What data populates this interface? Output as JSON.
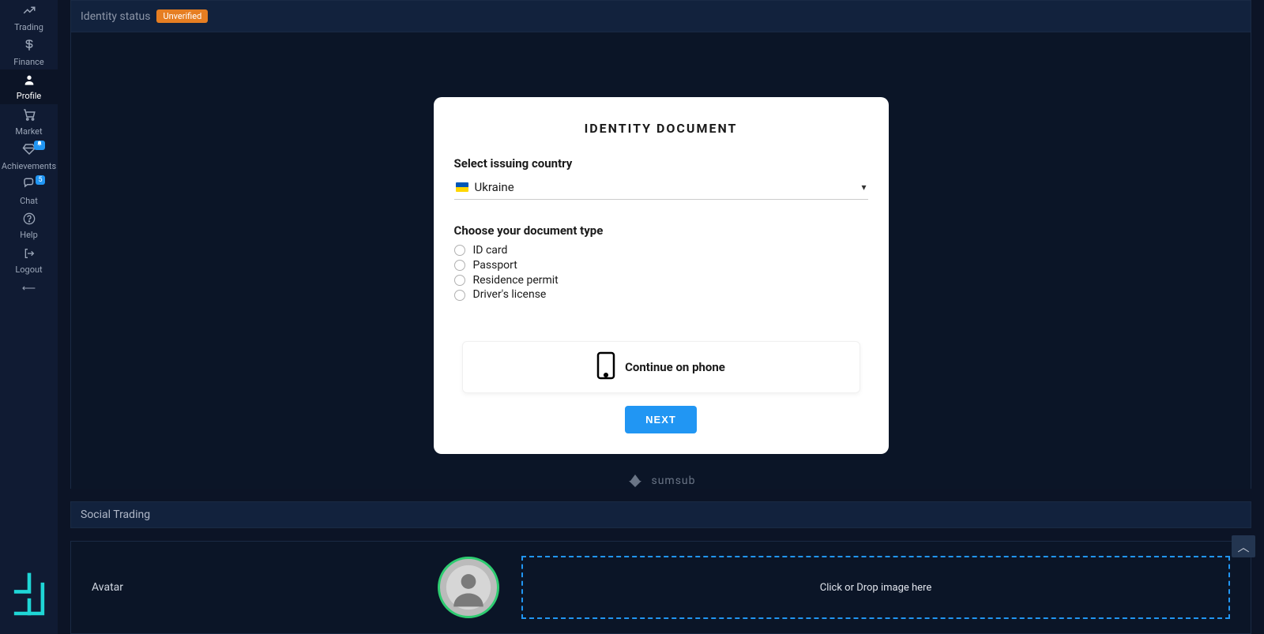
{
  "sidebar": {
    "items": [
      {
        "label": "Trading",
        "icon": "chart-line"
      },
      {
        "label": "Finance",
        "icon": "dollar"
      },
      {
        "label": "Profile",
        "icon": "user",
        "active": true
      },
      {
        "label": "Market",
        "icon": "cart"
      },
      {
        "label": "Achievements",
        "icon": "diamond",
        "badge": " "
      },
      {
        "label": "Chat",
        "icon": "comments",
        "badge": "5"
      },
      {
        "label": "Help",
        "icon": "question"
      },
      {
        "label": "Logout",
        "icon": "sign-out"
      }
    ]
  },
  "identity_status": {
    "label": "Identity status",
    "value": "Unverified"
  },
  "card": {
    "title": "IDENTITY DOCUMENT",
    "country_label": "Select issuing country",
    "country_value": "Ukraine",
    "doc_label": "Choose your document type",
    "doc_options": [
      "ID card",
      "Passport",
      "Residence permit",
      "Driver's license"
    ],
    "continue_phone": "Continue on phone",
    "next": "NEXT"
  },
  "branding": {
    "label": "sumsub"
  },
  "social": {
    "title": "Social Trading"
  },
  "avatar": {
    "label": "Avatar",
    "drop_text": "Click or Drop image here"
  }
}
